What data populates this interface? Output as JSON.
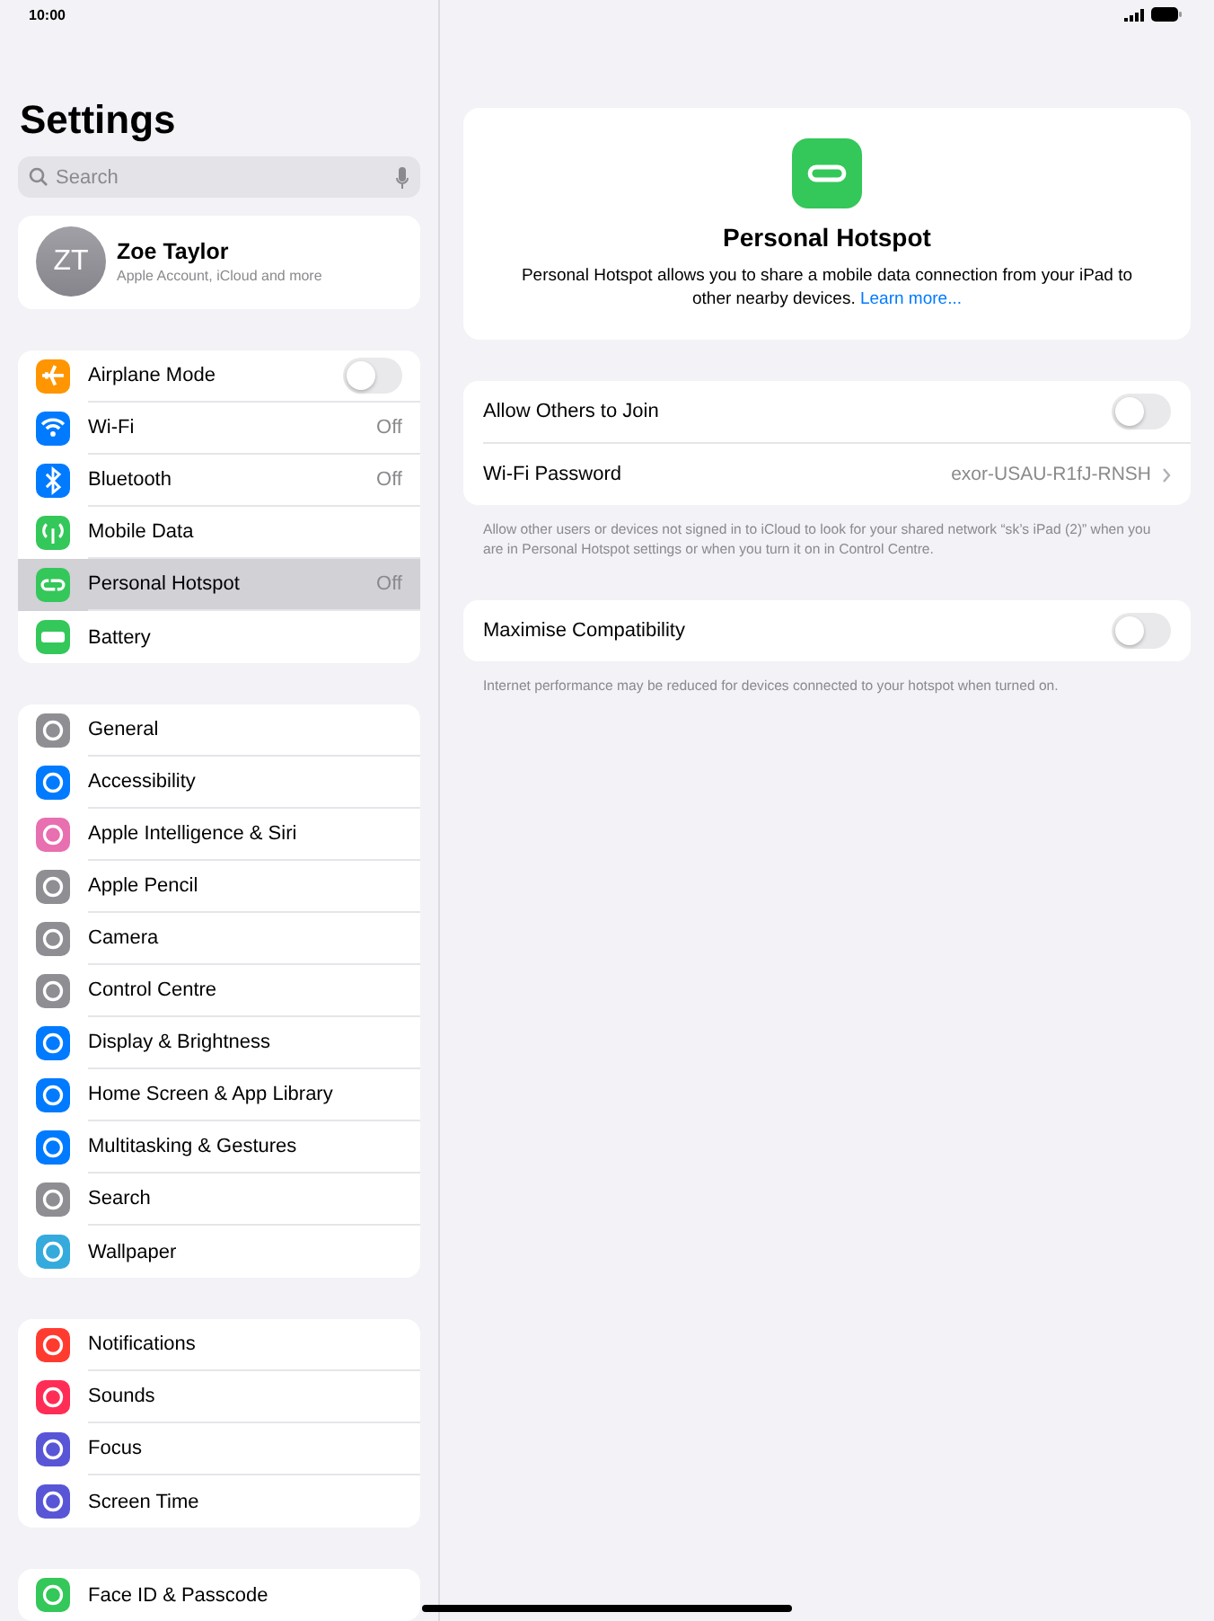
{
  "status_bar": {
    "time": "10:00"
  },
  "sidebar": {
    "title": "Settings",
    "search": {
      "placeholder": "Search"
    },
    "profile": {
      "initials": "ZT",
      "name": "Zoe Taylor",
      "subtitle": "Apple Account, iCloud and more"
    },
    "groups": [
      [
        {
          "label": "Airplane Mode",
          "color": "#ff9500",
          "kind": "toggle",
          "on": false,
          "selected": false
        },
        {
          "label": "Wi-Fi",
          "color": "#007aff",
          "kind": "value",
          "value": "Off",
          "selected": false
        },
        {
          "label": "Bluetooth",
          "color": "#007aff",
          "kind": "value",
          "value": "Off",
          "selected": false
        },
        {
          "label": "Mobile Data",
          "color": "#34c759",
          "kind": "link",
          "selected": false
        },
        {
          "label": "Personal Hotspot",
          "color": "#34c759",
          "kind": "value",
          "value": "Off",
          "selected": true
        },
        {
          "label": "Battery",
          "color": "#34c759",
          "kind": "link",
          "selected": false
        }
      ],
      [
        {
          "label": "General",
          "color": "#8e8e93",
          "kind": "link",
          "selected": false
        },
        {
          "label": "Accessibility",
          "color": "#007aff",
          "kind": "link",
          "selected": false
        },
        {
          "label": "Apple Intelligence & Siri",
          "color": "#e86fb0",
          "kind": "link",
          "selected": false
        },
        {
          "label": "Apple Pencil",
          "color": "#8e8e93",
          "kind": "link",
          "selected": false
        },
        {
          "label": "Camera",
          "color": "#8e8e93",
          "kind": "link",
          "selected": false
        },
        {
          "label": "Control Centre",
          "color": "#8e8e93",
          "kind": "link",
          "selected": false
        },
        {
          "label": "Display & Brightness",
          "color": "#007aff",
          "kind": "link",
          "selected": false
        },
        {
          "label": "Home Screen & App Library",
          "color": "#007aff",
          "kind": "link",
          "selected": false
        },
        {
          "label": "Multitasking & Gestures",
          "color": "#007aff",
          "kind": "link",
          "selected": false
        },
        {
          "label": "Search",
          "color": "#8e8e93",
          "kind": "link",
          "selected": false
        },
        {
          "label": "Wallpaper",
          "color": "#35aadc",
          "kind": "link",
          "selected": false
        }
      ],
      [
        {
          "label": "Notifications",
          "color": "#ff3b30",
          "kind": "link",
          "selected": false
        },
        {
          "label": "Sounds",
          "color": "#ff2d55",
          "kind": "link",
          "selected": false
        },
        {
          "label": "Focus",
          "color": "#5856d6",
          "kind": "link",
          "selected": false
        },
        {
          "label": "Screen Time",
          "color": "#5856d6",
          "kind": "link",
          "selected": false
        }
      ],
      [
        {
          "label": "Face ID & Passcode",
          "color": "#34c759",
          "kind": "link",
          "selected": false
        }
      ]
    ]
  },
  "detail": {
    "header": {
      "title": "Personal Hotspot",
      "description": "Personal Hotspot allows you to share a mobile data connection from your iPad to other nearby devices.",
      "link": "Learn more..."
    },
    "sections": [
      {
        "rows": [
          {
            "label": "Allow Others to Join",
            "kind": "toggle",
            "on": false
          },
          {
            "label": "Wi-Fi Password",
            "kind": "value",
            "value": "exor-USAU-R1fJ-RNSH"
          }
        ],
        "footer": "Allow other users or devices not signed in to iCloud to look for your shared network “sk’s iPad (2)” when you are in Personal Hotspot settings or when you turn it on in Control Centre."
      },
      {
        "rows": [
          {
            "label": "Maximise Compatibility",
            "kind": "toggle",
            "on": false
          }
        ],
        "footer": "Internet performance may be reduced for devices connected to your hotspot when turned on."
      }
    ]
  }
}
